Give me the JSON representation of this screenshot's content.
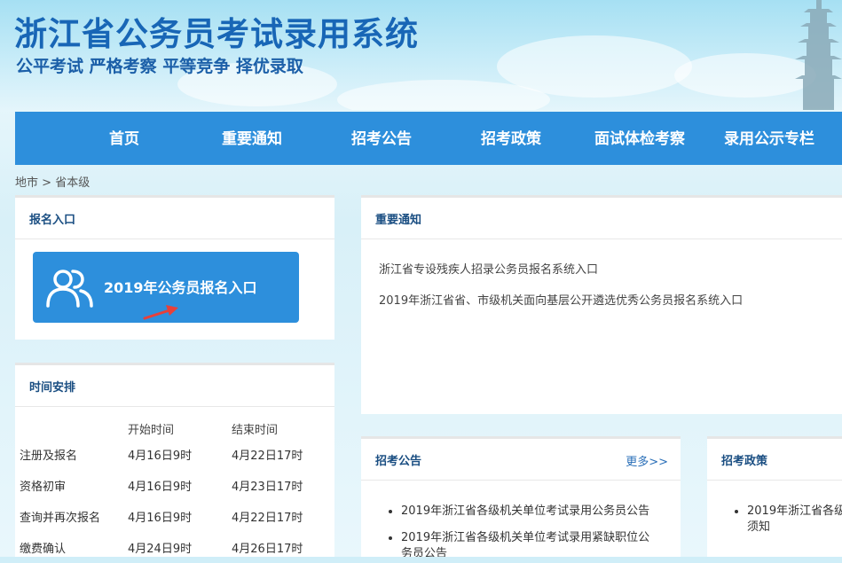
{
  "header": {
    "title": "浙江省公务员考试录用系统",
    "slogan": "公平考试 严格考察 平等竞争 择优录取"
  },
  "nav": {
    "items": [
      {
        "label": "首页"
      },
      {
        "label": "重要通知"
      },
      {
        "label": "招考公告"
      },
      {
        "label": "招考政策"
      },
      {
        "label": "面试体检考察"
      },
      {
        "label": "录用公示专栏"
      }
    ]
  },
  "breadcrumb": {
    "part1": "地市",
    "sep": " > ",
    "part2": "省本级"
  },
  "registration": {
    "panel_title": "报名入口",
    "button_label": "2019年公务员报名入口",
    "button_icon": "users-icon",
    "accent_color": "#2d8fdc",
    "arrow_color": "#e8403a"
  },
  "notices": {
    "panel_title": "重要通知",
    "items": [
      "浙江省专设残疾人招录公务员报名系统入口",
      "2019年浙江省省、市级机关面向基层公开遴选优秀公务员报名系统入口"
    ]
  },
  "schedule": {
    "panel_title": "时间安排",
    "col_start": "开始时间",
    "col_end": "结束时间",
    "rows": [
      {
        "name": "注册及报名",
        "start": "4月16日9时",
        "end": "4月22日17时"
      },
      {
        "name": "资格初审",
        "start": "4月16日9时",
        "end": "4月23日17时"
      },
      {
        "name": "查询并再次报名",
        "start": "4月16日9时",
        "end": "4月22日17时"
      },
      {
        "name": "缴费确认",
        "start": "4月24日9时",
        "end": "4月26日17时"
      }
    ]
  },
  "announcements": {
    "panel_title": "招考公告",
    "more": "更多>>",
    "items": [
      "2019年浙江省各级机关单位考试录用公务员公告",
      "2019年浙江省各级机关单位考试录用紧缺职位公",
      "务员公告"
    ]
  },
  "policy": {
    "panel_title": "招考政策",
    "items_line1": "2019年浙江省各级",
    "items_line2": "须知"
  }
}
